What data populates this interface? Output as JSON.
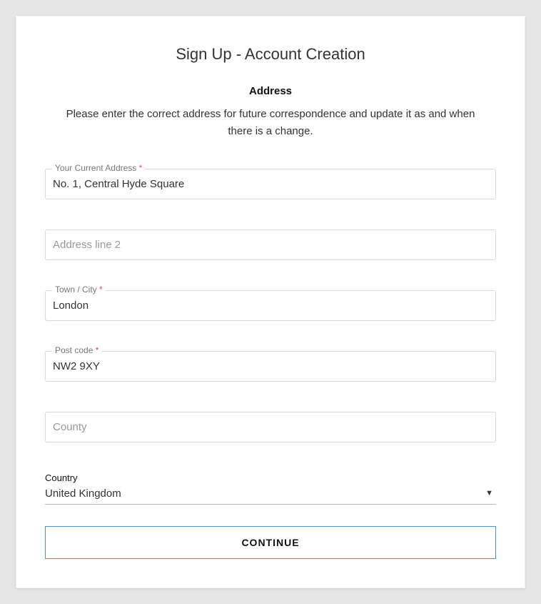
{
  "header": {
    "title": "Sign Up - Account Creation",
    "section_title": "Address",
    "instructions": "Please enter the correct address for future correspondence and update it as and when there is a change."
  },
  "fields": {
    "address1": {
      "label": "Your Current Address",
      "required_marker": "*",
      "value": "No. 1, Central Hyde Square"
    },
    "address2": {
      "placeholder": "Address line 2",
      "value": ""
    },
    "city": {
      "label": "Town / City",
      "required_marker": "*",
      "value": "London"
    },
    "postcode": {
      "label": "Post code",
      "required_marker": "*",
      "value": "NW2 9XY"
    },
    "county": {
      "placeholder": "County",
      "value": ""
    },
    "country": {
      "label": "Country",
      "value": "United Kingdom"
    }
  },
  "actions": {
    "continue_label": "CONTINUE"
  }
}
